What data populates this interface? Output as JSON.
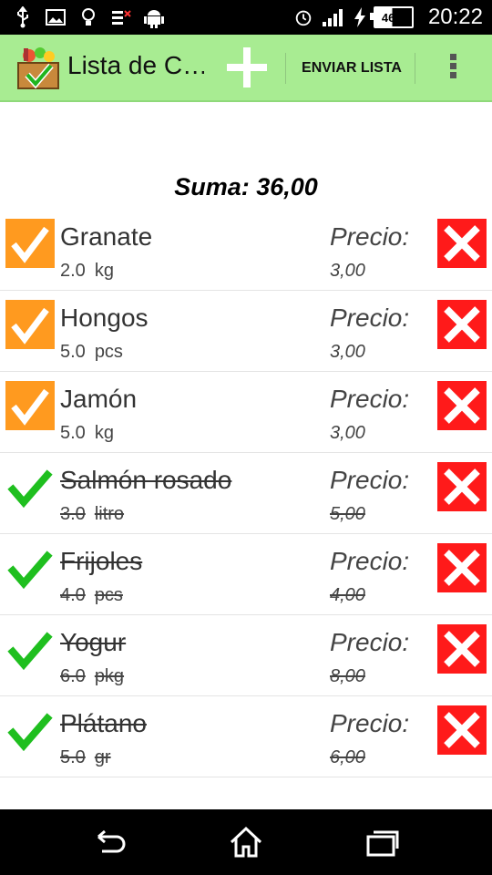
{
  "status_bar": {
    "battery": "46%",
    "time": "20:22",
    "left_icons": [
      "usb-icon",
      "image-icon",
      "lightbulb-icon",
      "signal-off-icon",
      "android-icon"
    ],
    "right_icons": [
      "alarm-icon",
      "signal-bars-icon",
      "charging-icon",
      "battery-icon"
    ]
  },
  "action_bar": {
    "title": "Lista de C…",
    "add_icon": "plus-icon",
    "send_label": "ENVIAR LISTA",
    "overflow_icon": "overflow-menu-icon"
  },
  "summary": {
    "label": "Suma: 36,00"
  },
  "items": [
    {
      "name": "Granate",
      "qty": "2.0",
      "unit": "kg",
      "price_label": "Precio:",
      "price": "3,00",
      "done": false
    },
    {
      "name": "Hongos",
      "qty": "5.0",
      "unit": "pcs",
      "price_label": "Precio:",
      "price": "3,00",
      "done": false
    },
    {
      "name": "Jamón",
      "qty": "5.0",
      "unit": "kg",
      "price_label": "Precio:",
      "price": "3,00",
      "done": false
    },
    {
      "name": "Salmón rosado",
      "qty": "3.0",
      "unit": "litro",
      "price_label": "Precio:",
      "price": "5,00",
      "done": true
    },
    {
      "name": "Frijoles",
      "qty": "4.0",
      "unit": "pcs",
      "price_label": "Precio:",
      "price": "4,00",
      "done": true
    },
    {
      "name": "Yogur",
      "qty": "6.0",
      "unit": "pkg",
      "price_label": "Precio:",
      "price": "8,00",
      "done": true
    },
    {
      "name": "Plátano",
      "qty": "5.0",
      "unit": "gr",
      "price_label": "Precio:",
      "price": "6,00",
      "done": true
    }
  ],
  "nav_bar": {
    "icons": [
      "back-icon",
      "home-icon",
      "recent-apps-icon"
    ]
  },
  "colors": {
    "action_bar": "#a8ec92",
    "checkbox_pending": "#ff9a1f",
    "check_done": "#1fbf1f",
    "delete": "#ff1a1a"
  }
}
